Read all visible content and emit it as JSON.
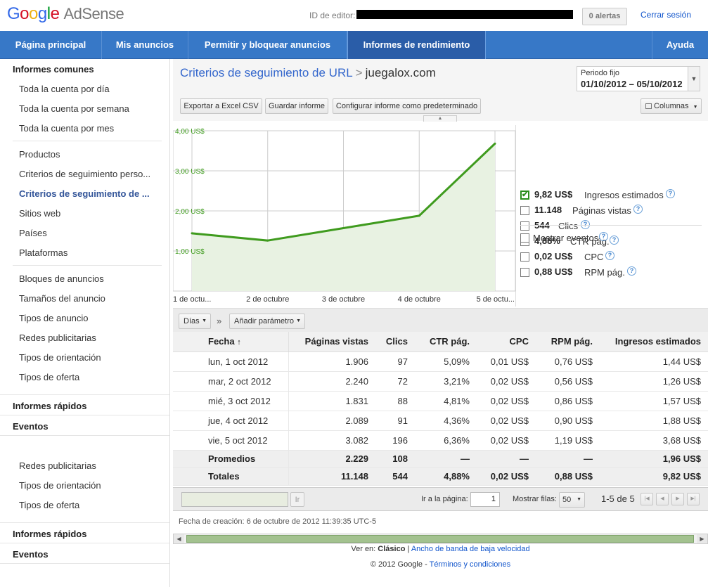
{
  "header": {
    "logo_google": "Google",
    "logo_product": "AdSense",
    "publisher_id_label": "ID de editor:",
    "alerts_label": "0 alertas",
    "sign_out": "Cerrar sesión"
  },
  "nav": {
    "tabs": [
      {
        "label": "Página principal"
      },
      {
        "label": "Mis anuncios"
      },
      {
        "label": "Permitir y bloquear anuncios"
      },
      {
        "label": "Informes de rendimiento"
      },
      {
        "label": "Ayuda"
      }
    ],
    "active": "Informes de rendimiento"
  },
  "sidebar": {
    "section1": "Informes comunes",
    "group1": [
      "Toda la cuenta por día",
      "Toda la cuenta por semana",
      "Toda la cuenta por mes"
    ],
    "group2": [
      "Productos",
      "Criterios de seguimiento perso...",
      "Criterios de seguimiento de ...",
      "Sitios web",
      "Países",
      "Plataformas"
    ],
    "group3": [
      "Bloques de anuncios",
      "Tamaños del anuncio",
      "Tipos de anuncio",
      "Redes publicitarias",
      "Tipos de orientación",
      "Tipos de oferta"
    ],
    "quick_reports": "Informes rápidos",
    "events": "Eventos",
    "group4": [
      "Redes publicitarias",
      "Tipos de orientación",
      "Tipos de oferta"
    ],
    "quick_reports_2": "Informes rápidos",
    "events_2": "Eventos"
  },
  "report": {
    "breadcrumb_link": "Criterios de seguimiento de URL",
    "breadcrumb_sep": ">",
    "breadcrumb_current": "juegalox.com",
    "date_label": "Periodo fijo",
    "date_value": "01/10/2012 – 05/10/2012",
    "btn_export": "Exportar a Excel CSV",
    "btn_save": "Guardar informe",
    "btn_config": "Configurar informe como predeterminado",
    "btn_columns": "Columnas"
  },
  "metrics": [
    {
      "value": "9,82 US$",
      "label": "Ingresos estimados",
      "checked": true
    },
    {
      "value": "11.148",
      "label": "Páginas vistas",
      "checked": false
    },
    {
      "value": "544",
      "label": "Clics",
      "checked": false
    },
    {
      "value": "4,88%",
      "label": "CTR pág.",
      "checked": false
    },
    {
      "value": "0,02 US$",
      "label": "CPC",
      "checked": false
    },
    {
      "value": "0,88 US$",
      "label": "RPM pág.",
      "checked": false
    }
  ],
  "show_events": "Mostrar eventos",
  "chart_data": {
    "type": "area",
    "x": [
      "1 de octu...",
      "2 de octubre",
      "3 de octubre",
      "4 de octubre",
      "5 de octu..."
    ],
    "series": [
      {
        "name": "Ingresos estimados",
        "values": [
          1.44,
          1.26,
          1.57,
          1.88,
          3.68
        ]
      }
    ],
    "ylim": [
      0,
      4
    ],
    "yticks": [
      "1,00 US$",
      "2,00 US$",
      "3,00 US$",
      "4,00 US$"
    ],
    "grid": true,
    "color": "#3f9b1e"
  },
  "controls": {
    "dim_select": "Días",
    "chevrons": "»",
    "add_param": "Añadir parámetro"
  },
  "table": {
    "columns": [
      "Fecha",
      "Páginas vistas",
      "Clics",
      "CTR pág.",
      "CPC",
      "RPM pág.",
      "Ingresos estimados"
    ],
    "sort_arrow": "↑",
    "rows": [
      [
        "lun, 1 oct 2012",
        "1.906",
        "97",
        "5,09%",
        "0,01 US$",
        "0,76 US$",
        "1,44 US$"
      ],
      [
        "mar, 2 oct 2012",
        "2.240",
        "72",
        "3,21%",
        "0,02 US$",
        "0,56 US$",
        "1,26 US$"
      ],
      [
        "mié, 3 oct 2012",
        "1.831",
        "88",
        "4,81%",
        "0,02 US$",
        "0,86 US$",
        "1,57 US$"
      ],
      [
        "jue, 4 oct 2012",
        "2.089",
        "91",
        "4,36%",
        "0,02 US$",
        "0,90 US$",
        "1,88 US$"
      ],
      [
        "vie, 5 oct 2012",
        "3.082",
        "196",
        "6,36%",
        "0,02 US$",
        "1,19 US$",
        "3,68 US$"
      ]
    ],
    "averages": [
      "Promedios",
      "2.229",
      "108",
      "—",
      "—",
      "—",
      "1,96 US$"
    ],
    "totals": [
      "Totales",
      "11.148",
      "544",
      "4,88%",
      "0,02 US$",
      "0,88 US$",
      "9,82 US$"
    ]
  },
  "pager": {
    "go_button": "Ir",
    "go_to_page_label": "Ir a la página:",
    "page_value": "1",
    "show_rows_label": "Mostrar filas:",
    "rows_value": "50",
    "range": "1-5 de 5"
  },
  "footer": {
    "created": "Fecha de creación: 6 de octubre de 2012 11:39:35 UTC-5",
    "view_in": "Ver en:",
    "classic": "Clásico",
    "sep": "|",
    "low_bandwidth": "Ancho de banda de baja velocidad",
    "copyright": "© 2012 Google",
    "dash": "-",
    "terms": "Términos y condiciones"
  }
}
